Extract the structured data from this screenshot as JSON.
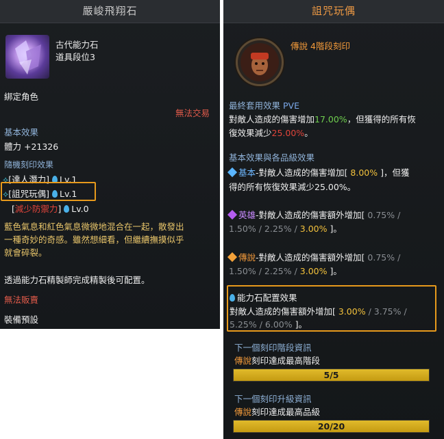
{
  "left": {
    "title": "嚴峻飛翔石",
    "item_type": "古代能力石",
    "item_tier": "道具段位3",
    "bound": "綁定角色",
    "no_trade": "無法交易",
    "base_effect_header": "基本效果",
    "base_effect_value": "體力 +21326",
    "random_engrave_header": "隨機刻印效果",
    "engravings": [
      {
        "name": "[達人潛力]",
        "level": "Lv.1",
        "type": "positive"
      },
      {
        "name": "[詛咒玩偶]",
        "level": "Lv.1",
        "type": "positive"
      },
      {
        "name": "減少防禦力",
        "level": "Lv.0",
        "type": "negative"
      }
    ],
    "flavor_text": [
      "藍色氣息和紅色氣息微微地混合在一起，散發出",
      "一種奇妙的奇感。雖然想細看，但繼續撫摸似乎",
      "就會碎裂。"
    ],
    "craft_note": "透過能力石精製師完成精製後可配置。",
    "no_sell": "無法販賣",
    "preset": "裝備預設"
  },
  "right": {
    "title": "詛咒玩偶",
    "grade_label": "傳說",
    "stage_label": "4階段刻印",
    "final_effect_header": "最終套用效果",
    "final_effect_mode": "PVE",
    "final_effect_line1_pre": "對敵人造成的傷害增加",
    "final_effect_dmg": "17.00%",
    "final_effect_line1_post": "，但獲得的所有恢",
    "final_effect_line2_pre": "復效果減少",
    "final_effect_heal": "25.00%",
    "final_effect_line2_post": "。",
    "grade_effects_header": "基本效果與各品級效果",
    "basic_label": "基本",
    "basic_text_pre": "-對敵人造成的傷害增加[",
    "basic_value": "8.00%",
    "basic_text_post": "]，但獲",
    "basic_line2": "得的所有恢復效果減少25.00%。",
    "hero_label": "英雄",
    "hero_text": "-對敵人造成的傷害額外增加[",
    "hero_v1": "0.75%",
    "hero_v2": "1.50%",
    "hero_v3": "2.25%",
    "hero_v4": "3.00%",
    "legend_label": "傳說",
    "legend_text": "-對敵人造成的傷害額外增加[",
    "legend_v1": "0.75%",
    "legend_v2": "1.50%",
    "legend_v3": "2.25%",
    "legend_v4": "3.00%",
    "stone_header": "能力石配置效果",
    "stone_text": "對敵人造成的傷害額外增加[",
    "stone_v1": "3.00%",
    "stone_v2": "3.75%",
    "stone_v3": "5.25%",
    "stone_v4": "6.00%",
    "next_stage_header": "下一個刻印階段資訊",
    "next_stage_grade": "傳說",
    "next_stage_text": "刻印達成最高階段",
    "next_stage_progress": "5/5",
    "next_stage_fraction": 1.0,
    "next_upgrade_header": "下一個刻印升級資訊",
    "next_upgrade_grade": "傳說",
    "next_upgrade_text": "刻印達成最高品級",
    "next_upgrade_progress": "20/20",
    "next_upgrade_fraction": 1.0
  },
  "colors": {
    "legend_orange": "#f39a3a",
    "highlight_border": "#e89a1c",
    "bar_fill": "#d8b020"
  }
}
